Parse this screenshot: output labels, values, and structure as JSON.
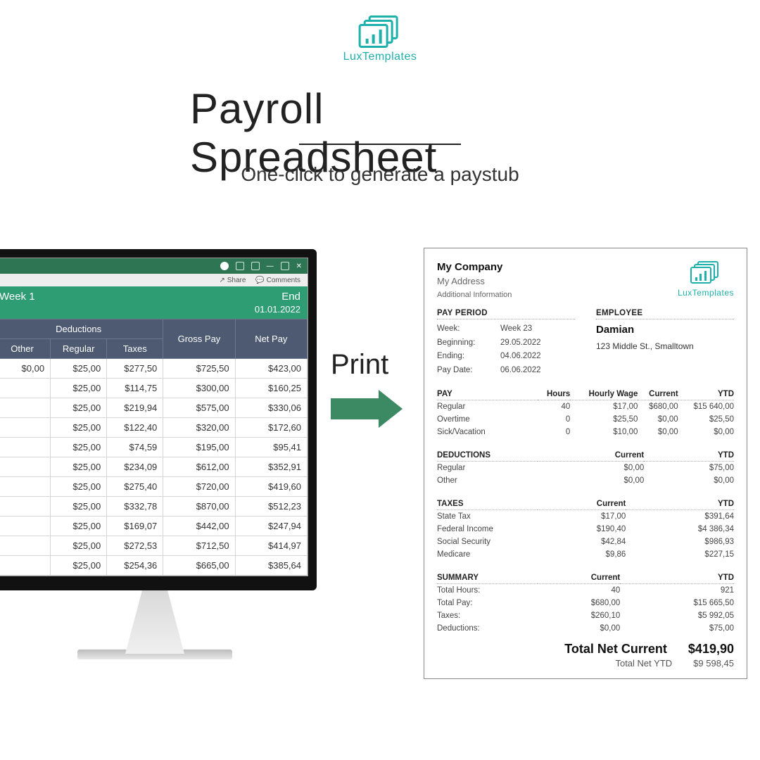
{
  "brand": "LuxTemplates",
  "title": "Payroll Spreadsheet",
  "subtitle": "One-click to generate a paystub",
  "print_label": "Print",
  "excel": {
    "share": "Share",
    "comments": "Comments",
    "week_label": "Week 1",
    "end_label": "End",
    "end_date": "01.01.2022",
    "headers": {
      "deductions": "Deductions",
      "other": "Other",
      "regular": "Regular",
      "taxes": "Taxes",
      "gross": "Gross Pay",
      "net": "Net Pay"
    },
    "rows": [
      {
        "other": "$0,00",
        "regular": "$25,00",
        "taxes": "$277,50",
        "gross": "$725,50",
        "net": "$423,00"
      },
      {
        "other": "",
        "regular": "$25,00",
        "taxes": "$114,75",
        "gross": "$300,00",
        "net": "$160,25"
      },
      {
        "other": "",
        "regular": "$25,00",
        "taxes": "$219,94",
        "gross": "$575,00",
        "net": "$330,06"
      },
      {
        "other": "",
        "regular": "$25,00",
        "taxes": "$122,40",
        "gross": "$320,00",
        "net": "$172,60"
      },
      {
        "other": "",
        "regular": "$25,00",
        "taxes": "$74,59",
        "gross": "$195,00",
        "net": "$95,41"
      },
      {
        "other": "",
        "regular": "$25,00",
        "taxes": "$234,09",
        "gross": "$612,00",
        "net": "$352,91"
      },
      {
        "other": "",
        "regular": "$25,00",
        "taxes": "$275,40",
        "gross": "$720,00",
        "net": "$419,60"
      },
      {
        "other": "",
        "regular": "$25,00",
        "taxes": "$332,78",
        "gross": "$870,00",
        "net": "$512,23"
      },
      {
        "other": "",
        "regular": "$25,00",
        "taxes": "$169,07",
        "gross": "$442,00",
        "net": "$247,94"
      },
      {
        "other": "",
        "regular": "$25,00",
        "taxes": "$272,53",
        "gross": "$712,50",
        "net": "$414,97"
      },
      {
        "other": "",
        "regular": "$25,00",
        "taxes": "$254,36",
        "gross": "$665,00",
        "net": "$385,64"
      }
    ]
  },
  "paystub": {
    "company": "My Company",
    "address": "My Address",
    "extra": "Additional Information",
    "period_title": "PAY PERIOD",
    "employee_title": "EMPLOYEE",
    "week_k": "Week:",
    "week_v": "Week 23",
    "begin_k": "Beginning:",
    "begin_v": "29.05.2022",
    "end_k": "Ending:",
    "end_v": "04.06.2022",
    "date_k": "Pay Date:",
    "date_v": "06.06.2022",
    "emp_name": "Damian",
    "emp_addr": "123 Middle St., Smalltown",
    "pay": {
      "title": "PAY",
      "h_hours": "Hours",
      "h_wage": "Hourly Wage",
      "h_cur": "Current",
      "h_ytd": "YTD",
      "rows": [
        {
          "label": "Regular",
          "hours": "40",
          "wage": "$17,00",
          "cur": "$680,00",
          "ytd": "$15 640,00"
        },
        {
          "label": "Overtime",
          "hours": "0",
          "wage": "$25,50",
          "cur": "$0,00",
          "ytd": "$25,50"
        },
        {
          "label": "Sick/Vacation",
          "hours": "0",
          "wage": "$10,00",
          "cur": "$0,00",
          "ytd": "$0,00"
        }
      ]
    },
    "ded": {
      "title": "DEDUCTIONS",
      "h_cur": "Current",
      "h_ytd": "YTD",
      "rows": [
        {
          "label": "Regular",
          "cur": "$0,00",
          "ytd": "$75,00"
        },
        {
          "label": "Other",
          "cur": "$0,00",
          "ytd": "$0,00"
        }
      ]
    },
    "tax": {
      "title": "TAXES",
      "h_cur": "Current",
      "h_ytd": "YTD",
      "rows": [
        {
          "label": "State Tax",
          "cur": "$17,00",
          "ytd": "$391,64"
        },
        {
          "label": "Federal Income",
          "cur": "$190,40",
          "ytd": "$4 386,34"
        },
        {
          "label": "Social Security",
          "cur": "$42,84",
          "ytd": "$986,93"
        },
        {
          "label": "Medicare",
          "cur": "$9,86",
          "ytd": "$227,15"
        }
      ]
    },
    "sum": {
      "title": "SUMMARY",
      "h_cur": "Current",
      "h_ytd": "YTD",
      "rows": [
        {
          "label": "Total Hours:",
          "cur": "40",
          "ytd": "921"
        },
        {
          "label": "Total Pay:",
          "cur": "$680,00",
          "ytd": "$15 665,50"
        },
        {
          "label": "Taxes:",
          "cur": "$260,10",
          "ytd": "$5 992,05"
        },
        {
          "label": "Deductions:",
          "cur": "$0,00",
          "ytd": "$75,00"
        }
      ]
    },
    "net_cur_label": "Total Net Current",
    "net_cur_value": "$419,90",
    "net_ytd_label": "Total Net YTD",
    "net_ytd_value": "$9 598,45"
  }
}
